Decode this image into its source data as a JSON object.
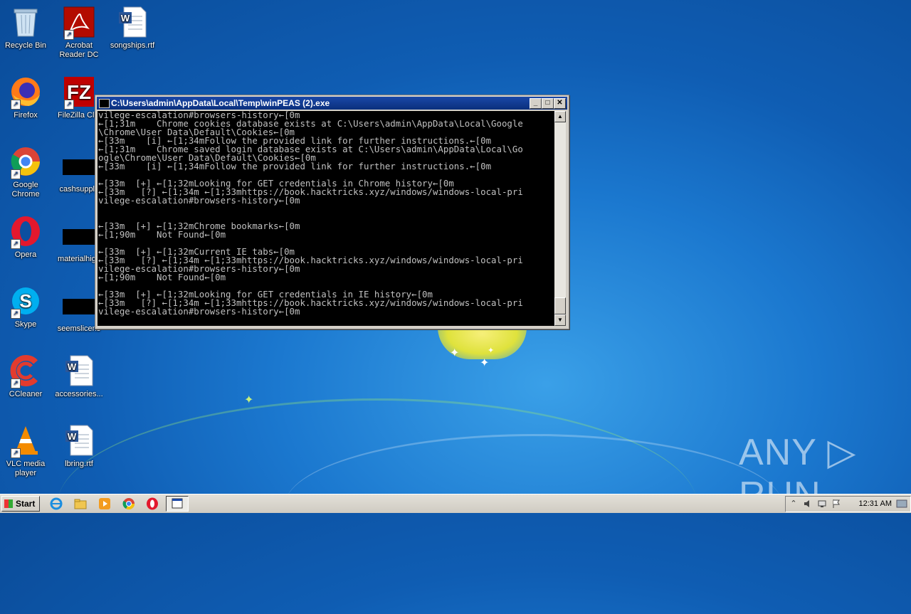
{
  "desktop": {
    "icons": [
      {
        "label": "Recycle Bin"
      },
      {
        "label": "Acrobat Reader DC"
      },
      {
        "label": "songships.rtf"
      },
      {
        "label": "Firefox"
      },
      {
        "label": "FileZilla Clie"
      },
      {
        "label": "Google Chrome"
      },
      {
        "label": "cashsupply"
      },
      {
        "label": "Opera"
      },
      {
        "label": "materialhigh"
      },
      {
        "label": "Skype"
      },
      {
        "label": "seemslicens"
      },
      {
        "label": "CCleaner"
      },
      {
        "label": "accessories..."
      },
      {
        "label": "VLC media player"
      },
      {
        "label": "lbring.rtf"
      }
    ]
  },
  "window": {
    "title": "C:\\Users\\admin\\AppData\\Local\\Temp\\winPEAS (2).exe",
    "minimize": "_",
    "maximize": "□",
    "close": "✕"
  },
  "console": {
    "lines": [
      "vilege-escalation#browsers-history←[0m",
      "←[1;31m    Chrome cookies database exists at C:\\Users\\admin\\AppData\\Local\\Google",
      "\\Chrome\\User Data\\Default\\Cookies←[0m",
      "←[33m    [i] ←[1;34mFollow the provided link for further instructions.←[0m",
      "←[1;31m    Chrome saved login database exists at C:\\Users\\admin\\AppData\\Local\\Go",
      "ogle\\Chrome\\User Data\\Default\\Cookies←[0m",
      "←[33m    [i] ←[1;34mFollow the provided link for further instructions.←[0m",
      "",
      "←[33m  [+] ←[1;32mLooking for GET credentials in Chrome history←[0m",
      "←[33m   [?] ←[1;34m ←[1;33mhttps://book.hacktricks.xyz/windows/windows-local-pri",
      "vilege-escalation#browsers-history←[0m",
      "",
      "",
      "←[33m  [+] ←[1;32mChrome bookmarks←[0m",
      "←[1;90m    Not Found←[0m",
      "",
      "←[33m  [+] ←[1;32mCurrent IE tabs←[0m",
      "←[33m   [?] ←[1;34m ←[1;33mhttps://book.hacktricks.xyz/windows/windows-local-pri",
      "vilege-escalation#browsers-history←[0m",
      "←[1;90m    Not Found←[0m",
      "",
      "←[33m  [+] ←[1;32mLooking for GET credentials in IE history←[0m",
      "←[33m   [?] ←[1;34m ←[1;33mhttps://book.hacktricks.xyz/windows/windows-local-pri",
      "vilege-escalation#browsers-history←[0m"
    ]
  },
  "scrollbar": {
    "up": "▲",
    "down": "▼"
  },
  "watermark": {
    "text": "ANY ▷ RUN"
  },
  "taskbar": {
    "start_label": "Start",
    "clock": "12:31 AM",
    "tray_up": "⌃"
  }
}
